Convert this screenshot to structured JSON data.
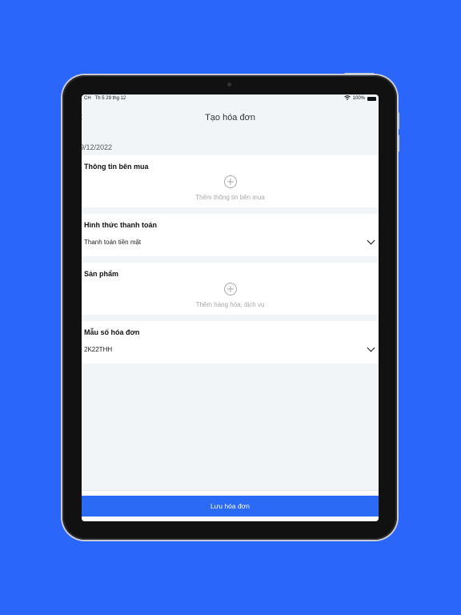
{
  "status_bar": {
    "left": "CH",
    "date_time": "Th 5 29 thg 12",
    "battery": "100%"
  },
  "nav": {
    "title": "Tạo hóa đơn",
    "back_glyph": "‹"
  },
  "date": "9/12/2022",
  "buyer_section": {
    "title": "Thông tin bên mua",
    "add_label": "Thêm thông tin bên mua"
  },
  "payment_section": {
    "title": "Hình thức thanh toán",
    "value": "Thanh toán tiền mặt"
  },
  "products_section": {
    "title": "Sản phẩm",
    "add_label": "Thêm hàng hóa, dịch vụ"
  },
  "template_section": {
    "title": "Mẫu số hóa đơn",
    "value": "2K22THH"
  },
  "save_button": "Lưu hóa đơn",
  "colors": {
    "background": "#2b66fb",
    "accent": "#2b6af5"
  }
}
